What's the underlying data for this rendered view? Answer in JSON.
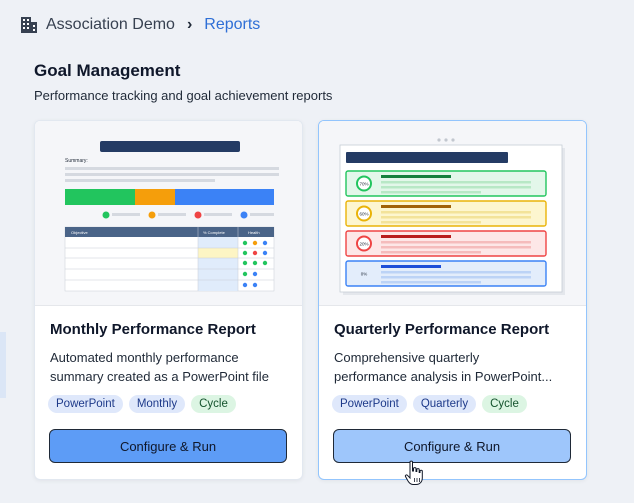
{
  "breadcrumb": {
    "root": "Association Demo",
    "current": "Reports"
  },
  "section": {
    "title": "Goal Management",
    "subtitle": "Performance tracking and goal achievement reports"
  },
  "cards": [
    {
      "title": "Monthly Performance Report",
      "desc_line1": "Automated monthly performance",
      "desc_line2": "summary created as a PowerPoint file",
      "tags": [
        "PowerPoint",
        "Monthly",
        "Cycle"
      ],
      "button": "Configure & Run",
      "preview": {
        "summary_label": "Summary:",
        "col_objective": "Objective",
        "col_complete": "% Complete",
        "col_health": "Health"
      }
    },
    {
      "title": "Quarterly Performance Report",
      "desc_line1": "Comprehensive quarterly",
      "desc_line2": "performance analysis in PowerPoint...",
      "tags": [
        "PowerPoint",
        "Quarterly",
        "Cycle"
      ],
      "button": "Configure & Run",
      "preview": {
        "progress": [
          "70%",
          "60%",
          "20%",
          "0%"
        ]
      }
    }
  ],
  "colors": {
    "accent": "#2f6fd6",
    "green": "#22c55e",
    "orange": "#f59e0b",
    "red": "#ef4444",
    "blue": "#3b82f6"
  },
  "icons": {
    "breadcrumb": "building-icon",
    "separator": "chevron-right-icon",
    "cursor": "hand-pointer-icon"
  }
}
